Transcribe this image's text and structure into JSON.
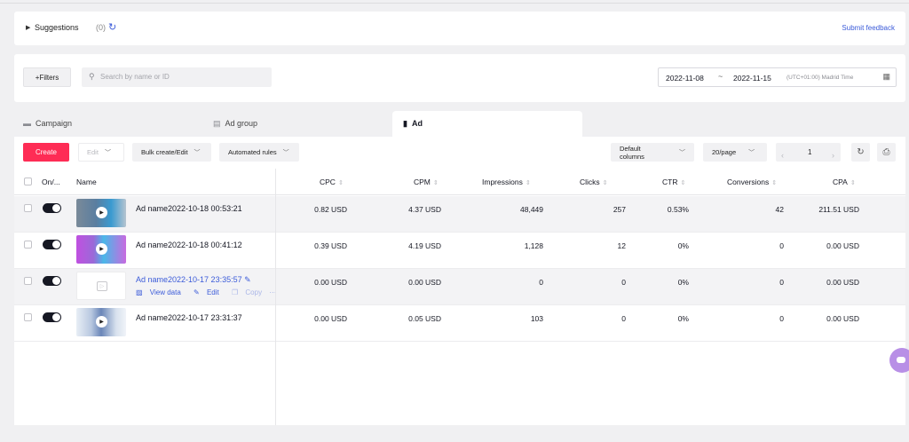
{
  "suggestions": {
    "title": "Suggestions",
    "count": "(0)",
    "refresh_icon": "refresh-icon",
    "feedback": "Submit feedback"
  },
  "filterbar": {
    "filters_label": "+Filters",
    "search_placeholder": "Search by name or ID",
    "date_start": "2022-11-08",
    "date_sep": "~",
    "date_end": "2022-11-15",
    "timezone": "(UTC+01:00) Madrid Time"
  },
  "tabs": [
    {
      "label": "Campaign",
      "icon": "folder-icon"
    },
    {
      "label": "Ad group",
      "icon": "grid-icon"
    },
    {
      "label": "Ad",
      "icon": "ad-icon",
      "active": true
    }
  ],
  "toolbar": {
    "create": "Create",
    "edit": "Edit",
    "bulk": "Bulk create/Edit",
    "automated": "Automated rules",
    "columns": "Default columns",
    "page_size": "20/page",
    "page": "1"
  },
  "table": {
    "headers": {
      "onoff": "On/...",
      "name": "Name",
      "cpc": "CPC",
      "cpm": "CPM",
      "impressions": "Impressions",
      "clicks": "Clicks",
      "ctr": "CTR",
      "conversions": "Conversions",
      "cpa": "CPA"
    },
    "rows": [
      {
        "name": "Ad name2022-10-18 00:53:21",
        "cpc": "0.82 USD",
        "cpm": "4.37 USD",
        "impressions": "48,449",
        "clicks": "257",
        "ctr": "0.53%",
        "conversions": "42",
        "cpa": "211.51 USD"
      },
      {
        "name": "Ad name2022-10-18 00:41:12",
        "cpc": "0.39 USD",
        "cpm": "4.19 USD",
        "impressions": "1,128",
        "clicks": "12",
        "ctr": "0%",
        "conversions": "0",
        "cpa": "0.00 USD"
      },
      {
        "name": "Ad name2022-10-17 23:35:57",
        "cpc": "0.00 USD",
        "cpm": "0.00 USD",
        "impressions": "0",
        "clicks": "0",
        "ctr": "0%",
        "conversions": "0",
        "cpa": "0.00 USD",
        "view_data": "View data",
        "edit": "Edit",
        "copy": "Copy"
      },
      {
        "name": "Ad name2022-10-17 23:31:37",
        "cpc": "0.00 USD",
        "cpm": "0.05 USD",
        "impressions": "103",
        "clicks": "0",
        "ctr": "0%",
        "conversions": "0",
        "cpa": "0.00 USD"
      }
    ]
  },
  "colors": {
    "accent": "#fe2c55",
    "link": "#3b5bd9",
    "chat_bubble": "#b88fe6"
  }
}
